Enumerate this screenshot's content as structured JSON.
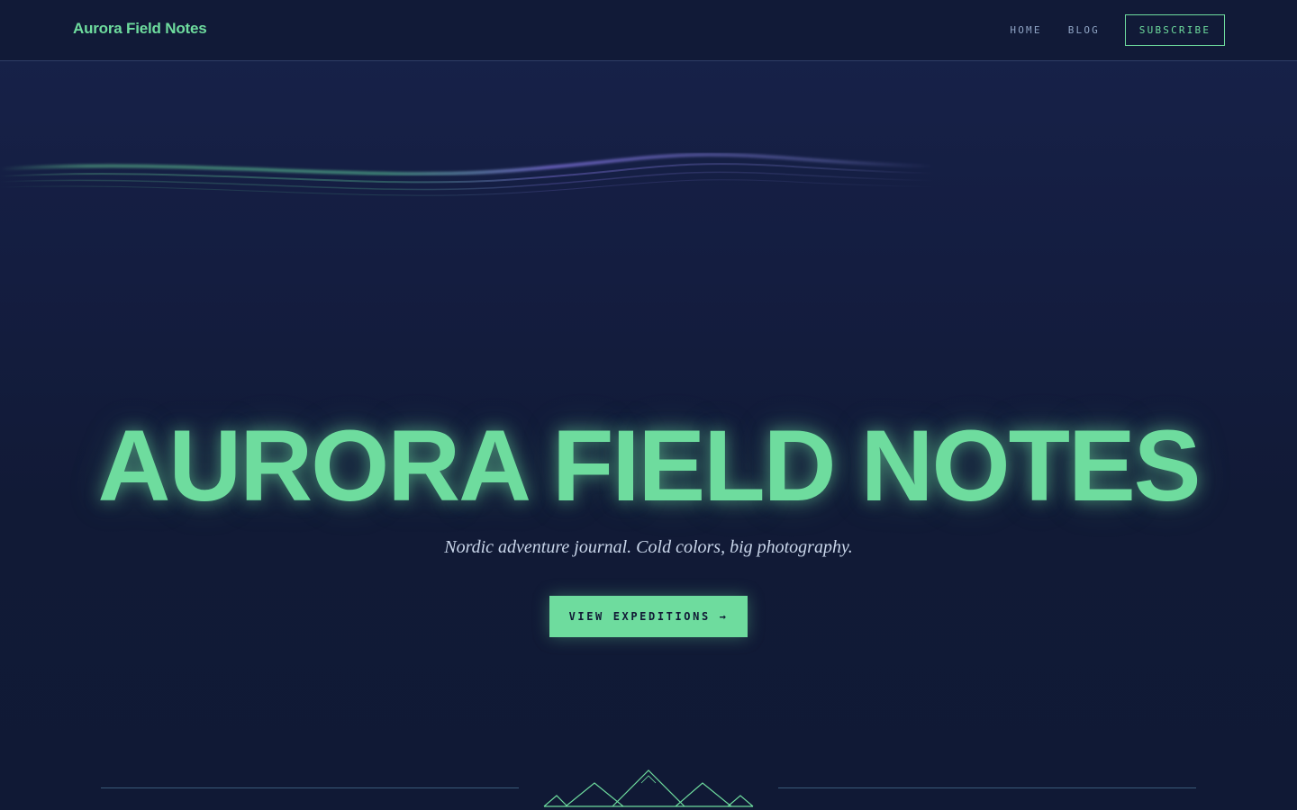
{
  "header": {
    "brand": "Aurora Field Notes",
    "nav": {
      "home": "HOME",
      "blog": "BLOG",
      "subscribe": "SUBSCRIBE"
    }
  },
  "hero": {
    "title": "AURORA FIELD NOTES",
    "subtitle": "Nordic adventure journal. Cold colors, big photography.",
    "cta_label": "VIEW EXPEDITIONS →"
  },
  "icons": {
    "aurora_wave": "aurora-wave-icon",
    "divider": "mountain-range-icon"
  },
  "colors": {
    "background": "#111a35",
    "accent": "#6edc9e",
    "aurora_purple": "#7c6fd8",
    "text_muted": "#8fa4c4",
    "subtitle": "#c9d6ea"
  }
}
